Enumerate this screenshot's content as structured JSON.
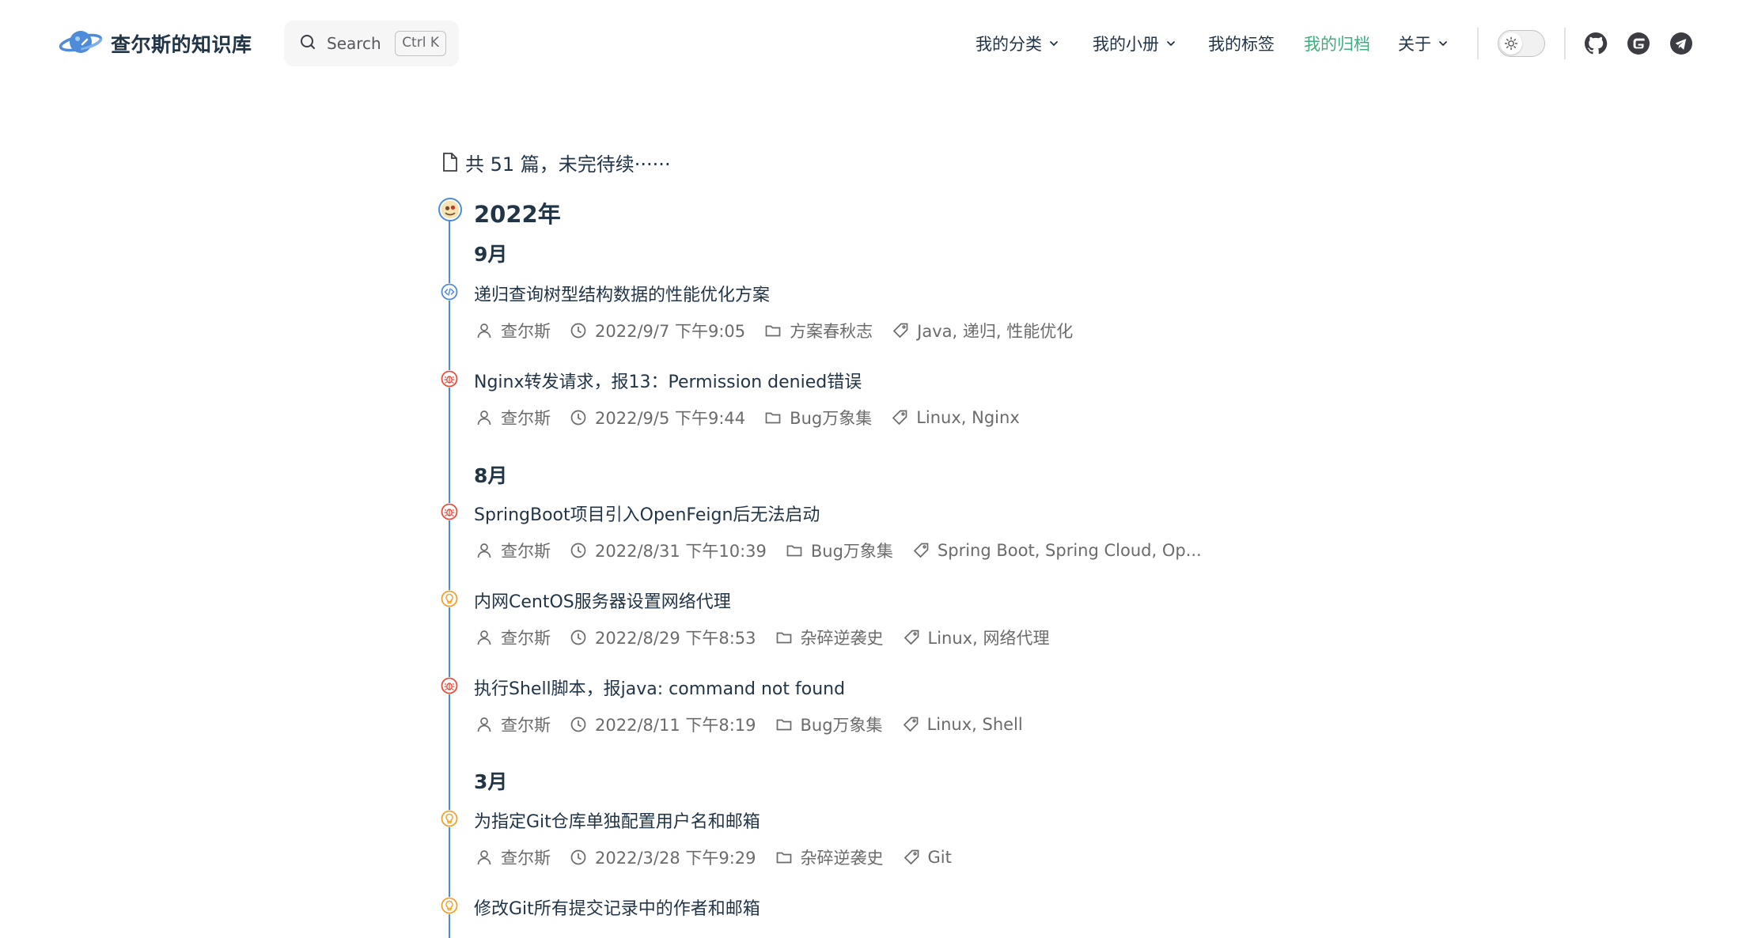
{
  "header": {
    "site_title": "查尔斯的知识库",
    "search": {
      "label": "Search",
      "shortcut": "Ctrl K"
    },
    "nav": [
      {
        "label": "我的分类",
        "dropdown": true,
        "active": false
      },
      {
        "label": "我的小册",
        "dropdown": true,
        "active": false
      },
      {
        "label": "我的标签",
        "dropdown": false,
        "active": false
      },
      {
        "label": "我的归档",
        "dropdown": false,
        "active": true
      },
      {
        "label": "关于",
        "dropdown": true,
        "active": false
      }
    ],
    "theme_switch_icon": "sun-icon",
    "social_icons": [
      "github-icon",
      "gitee-icon",
      "telegram-icon"
    ]
  },
  "colors": {
    "accent": "#3eaf7c",
    "timeline": "#4e8bd9",
    "text": "#213547",
    "meta": "#6b6b6b"
  },
  "archive": {
    "summary": "共 51 篇，未完待续······",
    "year": "2022年",
    "months": [
      {
        "label": "9月",
        "posts": [
          {
            "icon": "code-icon",
            "title": "递归查询树型结构数据的性能优化方案",
            "author": "查尔斯",
            "date": "2022/9/7 下午9:05",
            "category": "方案春秋志",
            "tags": "Java, 递归, 性能优化"
          },
          {
            "icon": "bug-icon",
            "title": "Nginx转发请求，报13：Permission denied错误",
            "author": "查尔斯",
            "date": "2022/9/5 下午9:44",
            "category": "Bug万象集",
            "tags": "Linux, Nginx"
          }
        ]
      },
      {
        "label": "8月",
        "posts": [
          {
            "icon": "bug-icon",
            "title": "SpringBoot项目引入OpenFeign后无法启动",
            "author": "查尔斯",
            "date": "2022/8/31 下午10:39",
            "category": "Bug万象集",
            "tags": "Spring Boot, Spring Cloud, Op..."
          },
          {
            "icon": "bulb-icon",
            "title": "内网CentOS服务器设置网络代理",
            "author": "查尔斯",
            "date": "2022/8/29 下午8:53",
            "category": "杂碎逆袭史",
            "tags": "Linux, 网络代理"
          },
          {
            "icon": "bug-icon",
            "title": "执行Shell脚本，报java: command not found",
            "author": "查尔斯",
            "date": "2022/8/11 下午8:19",
            "category": "Bug万象集",
            "tags": "Linux, Shell"
          }
        ]
      },
      {
        "label": "3月",
        "posts": [
          {
            "icon": "bulb-icon",
            "title": "为指定Git仓库单独配置用户名和邮箱",
            "author": "查尔斯",
            "date": "2022/3/28 下午9:29",
            "category": "杂碎逆袭史",
            "tags": "Git"
          },
          {
            "icon": "bulb-icon",
            "title": "修改Git所有提交记录中的作者和邮箱",
            "author": "查尔斯",
            "date": "",
            "category": "",
            "tags": ""
          }
        ]
      }
    ]
  }
}
